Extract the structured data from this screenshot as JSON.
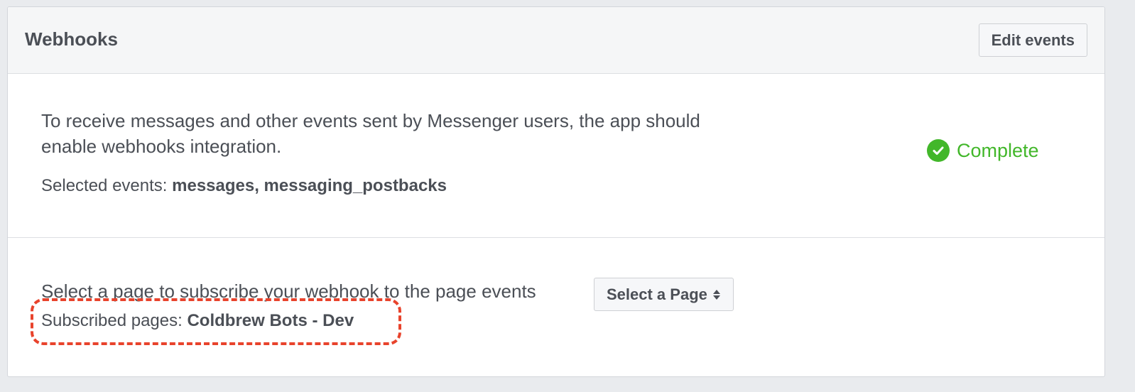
{
  "header": {
    "title": "Webhooks",
    "edit_button_label": "Edit events"
  },
  "webhooks": {
    "description": "To receive messages and other events sent by Messenger users, the app should enable webhooks integration.",
    "selected_events_label": "Selected events:",
    "selected_events_value": "messages, messaging_postbacks",
    "status_icon": "check-circle-icon",
    "status_text": "Complete",
    "status_color": "#42b72a"
  },
  "subscription": {
    "prompt": "Select a page to subscribe your webhook to the page events",
    "select_label": "Select a Page",
    "select_icon": "sort-arrows-icon",
    "subscribed_label": "Subscribed pages:",
    "subscribed_value": "Coldbrew Bots - Dev",
    "highlight_color": "#e8432c"
  }
}
